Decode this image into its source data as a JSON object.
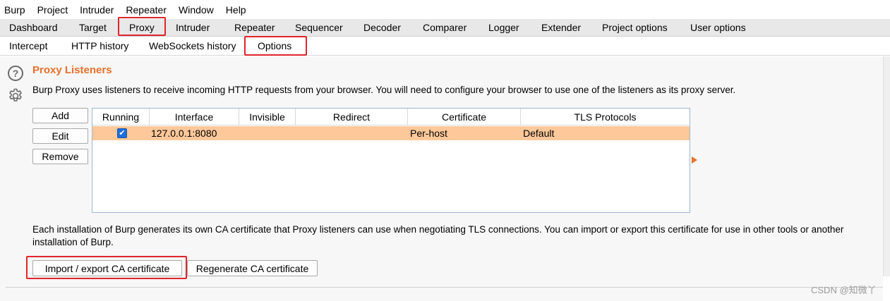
{
  "menubar": {
    "items": [
      "Burp",
      "Project",
      "Intruder",
      "Repeater",
      "Window",
      "Help"
    ]
  },
  "tabs": {
    "top": [
      "Dashboard",
      "Target",
      "Proxy",
      "Intruder",
      "Repeater",
      "Sequencer",
      "Decoder",
      "Comparer",
      "Logger",
      "Extender",
      "Project options",
      "User options"
    ],
    "active_top": "Proxy",
    "sub": [
      "Intercept",
      "HTTP history",
      "WebSockets history",
      "Options"
    ],
    "active_sub": "Options"
  },
  "section": {
    "title": "Proxy Listeners",
    "description": "Burp Proxy uses listeners to receive incoming HTTP requests from your browser. You will need to configure your browser to use one of the listeners as its proxy server."
  },
  "listener_buttons": {
    "add": "Add",
    "edit": "Edit",
    "remove": "Remove"
  },
  "table": {
    "columns": [
      "Running",
      "Interface",
      "Invisible",
      "Redirect",
      "Certificate",
      "TLS Protocols"
    ],
    "rows": [
      {
        "running": true,
        "interface": "127.0.0.1:8080",
        "invisible": "",
        "redirect": "",
        "certificate": "Per-host",
        "tls_protocols": "Default"
      }
    ]
  },
  "ca": {
    "description": "Each installation of Burp generates its own CA certificate that Proxy listeners can use when negotiating TLS connections. You can import or export this certificate for use in other tools or another installation of Burp.",
    "import_export_label": "Import / export CA certificate",
    "regenerate_label": "Regenerate CA certificate"
  },
  "watermark": "CSDN @知微丫",
  "colors": {
    "accent": "#e8702a",
    "highlight_row": "#ffc89a",
    "annotation_box": "#e0252b"
  },
  "icons": {
    "help": "help-circle-icon",
    "settings": "gear-icon",
    "checkbox": "checkbox-checked-icon",
    "expand": "triangle-right-icon"
  }
}
